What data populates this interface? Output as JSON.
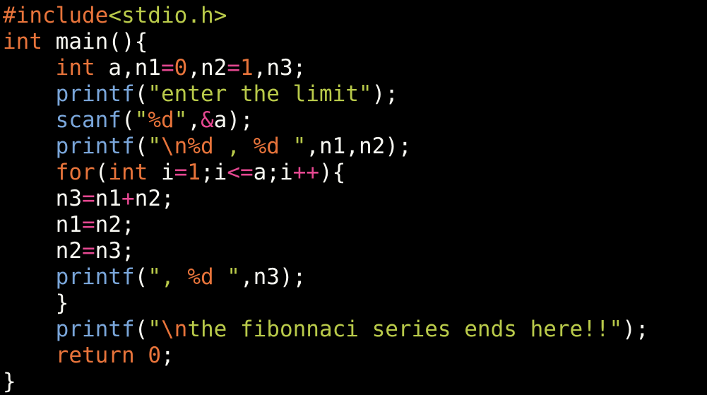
{
  "theme": {
    "background": "#000000",
    "default_text": "#f8f8f2",
    "preprocessor": "#e8743b",
    "keyword": "#e8743b",
    "function": "#7aa6da",
    "string": "#b9ca4a",
    "number": "#e8743b",
    "operator": "#e54891",
    "format_specifier": "#e8743b",
    "escape": "#e8743b"
  },
  "code": {
    "language": "c",
    "lines": [
      {
        "tokens": [
          {
            "text": "#include",
            "type": "preprocessor"
          },
          {
            "text": "<stdio.h>",
            "type": "string"
          }
        ]
      },
      {
        "tokens": [
          {
            "text": "int",
            "type": "keyword"
          },
          {
            "text": " main(){",
            "type": "default_text"
          }
        ]
      },
      {
        "tokens": [
          {
            "text": "    ",
            "type": "default_text"
          },
          {
            "text": "int",
            "type": "keyword"
          },
          {
            "text": " a,n1",
            "type": "default_text"
          },
          {
            "text": "=",
            "type": "operator"
          },
          {
            "text": "0",
            "type": "number"
          },
          {
            "text": ",n2",
            "type": "default_text"
          },
          {
            "text": "=",
            "type": "operator"
          },
          {
            "text": "1",
            "type": "number"
          },
          {
            "text": ",n3;",
            "type": "default_text"
          }
        ]
      },
      {
        "tokens": [
          {
            "text": "    ",
            "type": "default_text"
          },
          {
            "text": "printf",
            "type": "function"
          },
          {
            "text": "(",
            "type": "default_text"
          },
          {
            "text": "\"enter the limit\"",
            "type": "string"
          },
          {
            "text": ");",
            "type": "default_text"
          }
        ]
      },
      {
        "tokens": [
          {
            "text": "    ",
            "type": "default_text"
          },
          {
            "text": "scanf",
            "type": "function"
          },
          {
            "text": "(",
            "type": "default_text"
          },
          {
            "text": "\"",
            "type": "string"
          },
          {
            "text": "%d",
            "type": "format_specifier"
          },
          {
            "text": "\"",
            "type": "string"
          },
          {
            "text": ",",
            "type": "default_text"
          },
          {
            "text": "&",
            "type": "operator"
          },
          {
            "text": "a);",
            "type": "default_text"
          }
        ]
      },
      {
        "tokens": [
          {
            "text": "    ",
            "type": "default_text"
          },
          {
            "text": "printf",
            "type": "function"
          },
          {
            "text": "(",
            "type": "default_text"
          },
          {
            "text": "\"",
            "type": "string"
          },
          {
            "text": "\\n",
            "type": "escape"
          },
          {
            "text": "%d",
            "type": "format_specifier"
          },
          {
            "text": " , ",
            "type": "string"
          },
          {
            "text": "%d",
            "type": "format_specifier"
          },
          {
            "text": " \"",
            "type": "string"
          },
          {
            "text": ",n1,n2);",
            "type": "default_text"
          }
        ]
      },
      {
        "tokens": [
          {
            "text": "    ",
            "type": "default_text"
          },
          {
            "text": "for",
            "type": "keyword"
          },
          {
            "text": "(",
            "type": "default_text"
          },
          {
            "text": "int",
            "type": "keyword"
          },
          {
            "text": " i",
            "type": "default_text"
          },
          {
            "text": "=",
            "type": "operator"
          },
          {
            "text": "1",
            "type": "number"
          },
          {
            "text": ";i",
            "type": "default_text"
          },
          {
            "text": "<=",
            "type": "operator"
          },
          {
            "text": "a;i",
            "type": "default_text"
          },
          {
            "text": "++",
            "type": "operator"
          },
          {
            "text": "){",
            "type": "default_text"
          }
        ]
      },
      {
        "tokens": [
          {
            "text": "    n3",
            "type": "default_text"
          },
          {
            "text": "=",
            "type": "operator"
          },
          {
            "text": "n1",
            "type": "default_text"
          },
          {
            "text": "+",
            "type": "operator"
          },
          {
            "text": "n2;",
            "type": "default_text"
          }
        ]
      },
      {
        "tokens": [
          {
            "text": "    n1",
            "type": "default_text"
          },
          {
            "text": "=",
            "type": "operator"
          },
          {
            "text": "n2;",
            "type": "default_text"
          }
        ]
      },
      {
        "tokens": [
          {
            "text": "    n2",
            "type": "default_text"
          },
          {
            "text": "=",
            "type": "operator"
          },
          {
            "text": "n3;",
            "type": "default_text"
          }
        ]
      },
      {
        "tokens": [
          {
            "text": "    ",
            "type": "default_text"
          },
          {
            "text": "printf",
            "type": "function"
          },
          {
            "text": "(",
            "type": "default_text"
          },
          {
            "text": "\", ",
            "type": "string"
          },
          {
            "text": "%d",
            "type": "format_specifier"
          },
          {
            "text": " \"",
            "type": "string"
          },
          {
            "text": ",n3);",
            "type": "default_text"
          }
        ]
      },
      {
        "tokens": [
          {
            "text": "    }",
            "type": "default_text"
          }
        ]
      },
      {
        "tokens": [
          {
            "text": "    ",
            "type": "default_text"
          },
          {
            "text": "printf",
            "type": "function"
          },
          {
            "text": "(",
            "type": "default_text"
          },
          {
            "text": "\"",
            "type": "string"
          },
          {
            "text": "\\n",
            "type": "escape"
          },
          {
            "text": "the fibonnaci series ends here!!\"",
            "type": "string"
          },
          {
            "text": ");",
            "type": "default_text"
          }
        ]
      },
      {
        "tokens": [
          {
            "text": "    ",
            "type": "default_text"
          },
          {
            "text": "return",
            "type": "keyword"
          },
          {
            "text": " ",
            "type": "default_text"
          },
          {
            "text": "0",
            "type": "number"
          },
          {
            "text": ";",
            "type": "default_text"
          }
        ]
      },
      {
        "tokens": [
          {
            "text": "}",
            "type": "default_text"
          }
        ]
      }
    ]
  }
}
